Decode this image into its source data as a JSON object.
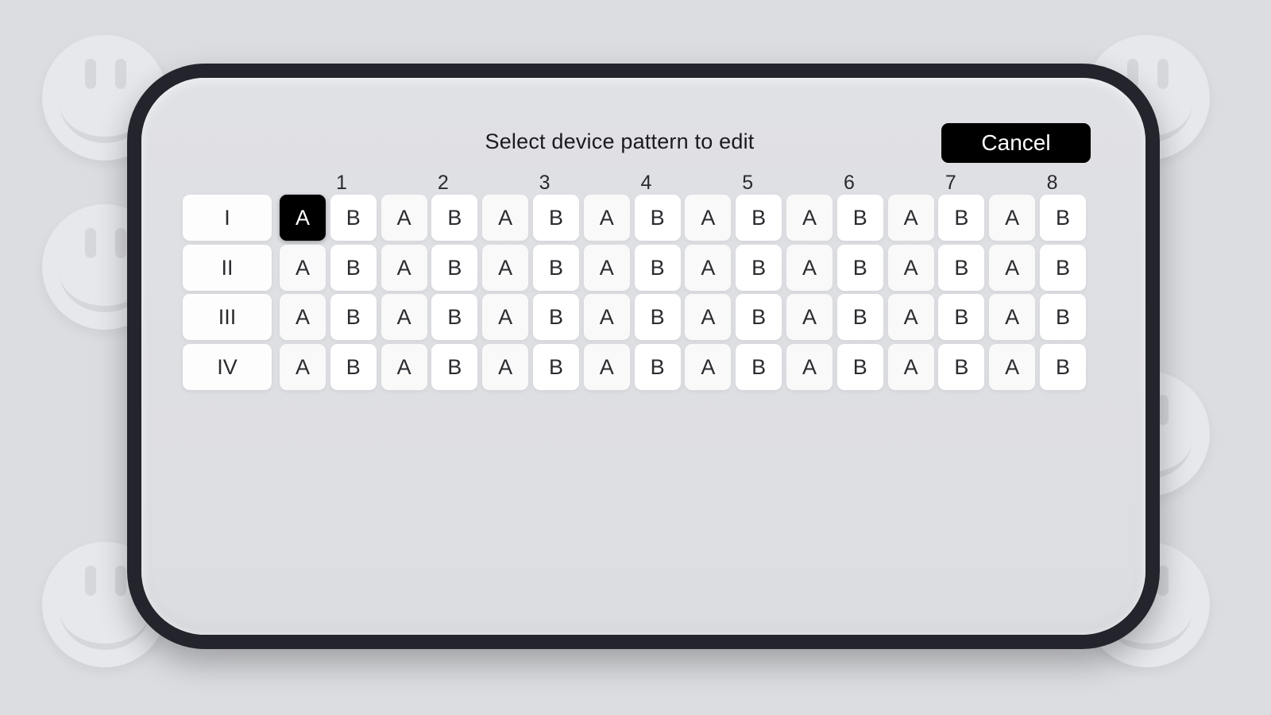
{
  "dialog": {
    "title": "Select device pattern to edit",
    "cancel_label": "Cancel"
  },
  "columns": [
    "1",
    "2",
    "3",
    "4",
    "5",
    "6",
    "7",
    "8"
  ],
  "rows": [
    {
      "label": "I",
      "cells": [
        "A",
        "B",
        "A",
        "B",
        "A",
        "B",
        "A",
        "B",
        "A",
        "B",
        "A",
        "B",
        "A",
        "B",
        "A",
        "B"
      ]
    },
    {
      "label": "II",
      "cells": [
        "A",
        "B",
        "A",
        "B",
        "A",
        "B",
        "A",
        "B",
        "A",
        "B",
        "A",
        "B",
        "A",
        "B",
        "A",
        "B"
      ]
    },
    {
      "label": "III",
      "cells": [
        "A",
        "B",
        "A",
        "B",
        "A",
        "B",
        "A",
        "B",
        "A",
        "B",
        "A",
        "B",
        "A",
        "B",
        "A",
        "B"
      ]
    },
    {
      "label": "IV",
      "cells": [
        "A",
        "B",
        "A",
        "B",
        "A",
        "B",
        "A",
        "B",
        "A",
        "B",
        "A",
        "B",
        "A",
        "B",
        "A",
        "B"
      ]
    }
  ],
  "selected": {
    "row": 0,
    "cell": 0
  },
  "colors": {
    "background": "#dcdde1",
    "frame": "#23242c",
    "selected_cell": "#000000",
    "cell": "#ffffff"
  }
}
